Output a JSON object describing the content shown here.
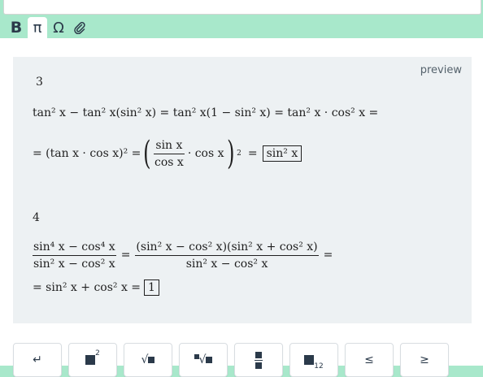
{
  "toolbar": {
    "bold": "B",
    "pi": "π",
    "omega": "Ω",
    "attach_icon": "paperclip-icon"
  },
  "preview": {
    "label": "preview",
    "problem3": {
      "number": "3",
      "line1": "tan² x − tan² x(sin² x) = tan² x(1 − sin² x) = tan² x · cos² x =",
      "line2_prefix": "= (tan x · cos x)² =",
      "frac_num": "sin x",
      "frac_den": "cos x",
      "line2_mid": "· cos x",
      "line2_eq": "=",
      "answer": "sin² x"
    },
    "problem4": {
      "number": "4",
      "frac1_num": "sin⁴ x − cos⁴ x",
      "frac1_den": "sin² x − cos² x",
      "frac2_num": "(sin² x − cos² x)(sin² x + cos² x)",
      "frac2_den": "sin² x − cos² x",
      "eq": "=",
      "line2": "= sin² x + cos² x =",
      "answer": "1"
    }
  },
  "keyboard": {
    "keys": [
      {
        "name": "enter-key",
        "label": "↵"
      },
      {
        "name": "square-key",
        "sup": "2"
      },
      {
        "name": "sqrt-key",
        "label": "√"
      },
      {
        "name": "nth-root-key",
        "label": "√"
      },
      {
        "name": "fraction-key"
      },
      {
        "name": "subscript-key",
        "sub": "12"
      },
      {
        "name": "leq-key",
        "label": "≤"
      },
      {
        "name": "geq-key",
        "label": "≥"
      }
    ]
  }
}
